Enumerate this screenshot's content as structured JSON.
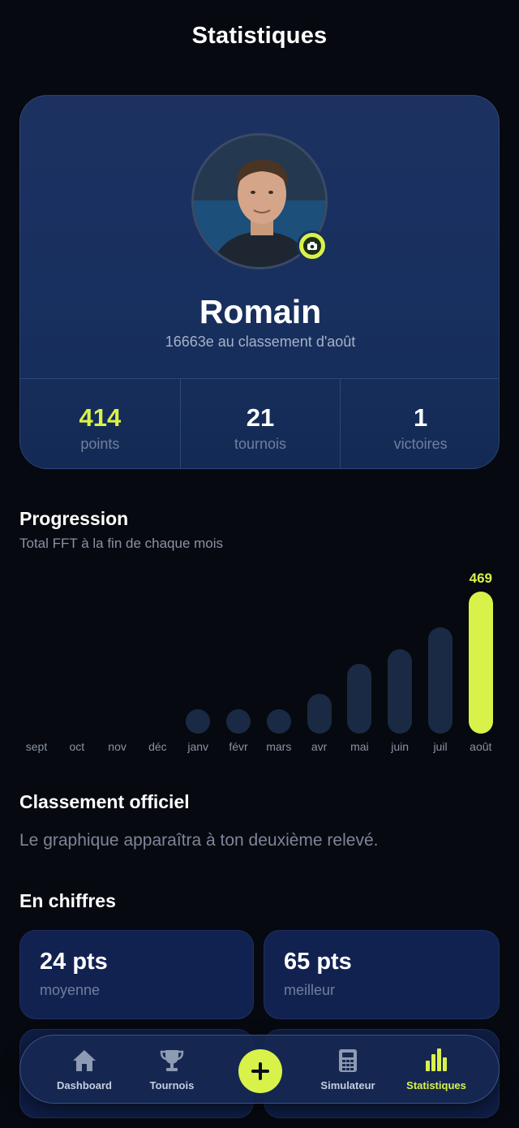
{
  "header": {
    "title": "Statistiques"
  },
  "profile": {
    "name": "Romain",
    "rank_text": "16663e au classement d'août",
    "stats": [
      {
        "value": "414",
        "label": "points"
      },
      {
        "value": "21",
        "label": "tournois"
      },
      {
        "value": "1",
        "label": "victoires"
      }
    ]
  },
  "progression": {
    "title": "Progression",
    "subtitle": "Total FFT à la fin de chaque mois"
  },
  "chart_data": {
    "type": "bar",
    "title": "Progression",
    "subtitle": "Total FFT à la fin de chaque mois",
    "categories": [
      "sept",
      "oct",
      "nov",
      "déc",
      "janv",
      "févr",
      "mars",
      "avr",
      "mai",
      "juin",
      "juil",
      "août"
    ],
    "values": [
      null,
      null,
      null,
      null,
      14,
      60,
      80,
      130,
      230,
      280,
      350,
      469
    ],
    "highlighted": "août",
    "highlighted_label": "469",
    "ylim": [
      0,
      469
    ],
    "colors": {
      "bar": "#1a2a44",
      "highlight": "#d9f24a"
    }
  },
  "official_ranking": {
    "title": "Classement officiel",
    "text": "Le graphique apparaîtra à ton deuxième relevé."
  },
  "figures": {
    "title": "En chiffres",
    "cards": [
      {
        "value": "24 pts",
        "label": "moyenne"
      },
      {
        "value": "65 pts",
        "label": "meilleur"
      }
    ]
  },
  "tabbar": {
    "items": [
      {
        "label": "Dashboard",
        "icon": "home-icon"
      },
      {
        "label": "Tournois",
        "icon": "trophy-icon"
      },
      {
        "label": "Simulateur",
        "icon": "calculator-icon"
      },
      {
        "label": "Statistiques",
        "icon": "bar-chart-icon"
      }
    ],
    "add_icon": "plus-icon"
  },
  "colors": {
    "accent": "#d9f24a",
    "background": "#06090f",
    "card": "#18305f"
  }
}
